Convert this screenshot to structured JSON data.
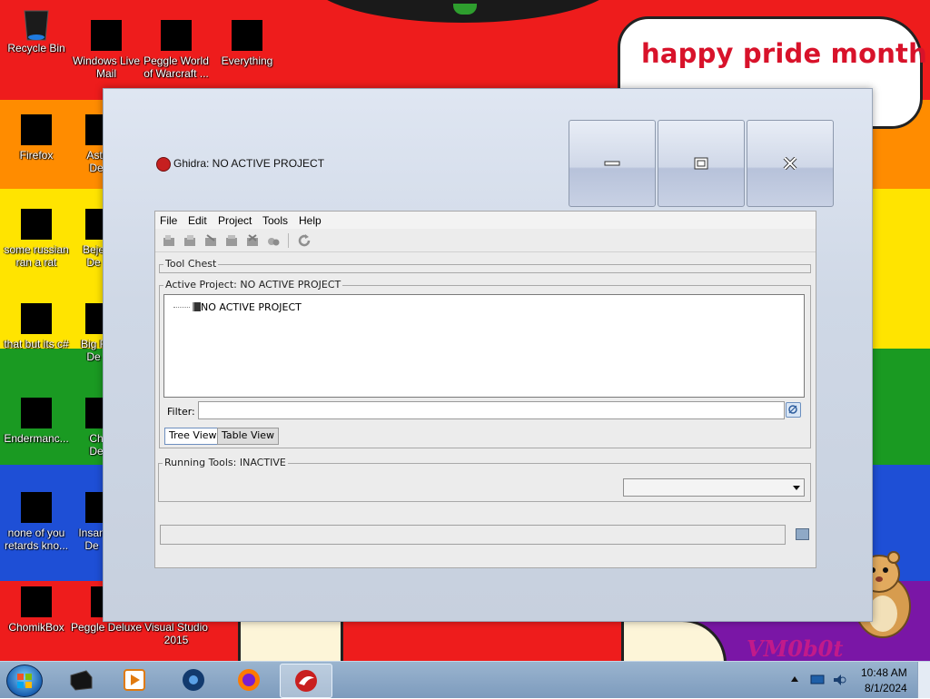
{
  "desktop": {
    "bubble_text": "happy pride month",
    "signature": "VM0b0t",
    "icons": [
      {
        "label": "Recycle Bin"
      },
      {
        "label": "Windows Live Mail"
      },
      {
        "label": "Peggle World of Warcraft ..."
      },
      {
        "label": "Everything"
      },
      {
        "label": "Firefox"
      },
      {
        "label": "Astr De"
      },
      {
        "label": "some russian ran a rat"
      },
      {
        "label": "Beje De"
      },
      {
        "label": "that but its c#"
      },
      {
        "label": "Big F De"
      },
      {
        "label": "Endermanc..."
      },
      {
        "label": "Ch De"
      },
      {
        "label": "none of you retards kno..."
      },
      {
        "label": "Insan De"
      },
      {
        "label": "ChomikBox"
      },
      {
        "label": "Peggle Deluxe"
      },
      {
        "label": "Visual Studio 2015"
      }
    ],
    "colors": {
      "red": "#ee1c1c",
      "orange": "#ff8c00",
      "yellow": "#ffe400",
      "green": "#1a9a22",
      "blue": "#1e4fd6",
      "purple": "#7a16a6"
    }
  },
  "window": {
    "title": "Ghidra: NO ACTIVE PROJECT",
    "menu": [
      "File",
      "Edit",
      "Project",
      "Tools",
      "Help"
    ],
    "toolbar_icons": [
      "new-project-icon",
      "open-project-icon",
      "close-project-icon",
      "save-project-icon",
      "delete-project-icon",
      "archive-icon",
      "refresh-icon"
    ],
    "tool_chest_title": "Tool Chest",
    "active_project_title": "Active Project: NO ACTIVE PROJECT",
    "tree_node": "NO ACTIVE PROJECT",
    "filter_label": "Filter:",
    "filter_value": "",
    "tabs": [
      "Tree View",
      "Table View"
    ],
    "selected_tab": "Tree View",
    "running_tools_title": "Running Tools: INACTIVE",
    "running_tools_selected": "",
    "status_text": ""
  },
  "taskbar": {
    "items": [
      "black-app-icon",
      "media-player-icon",
      "chromium-icon",
      "firefox-icon",
      "ghidra-icon"
    ],
    "time": "10:48 AM",
    "date": "8/1/2024"
  }
}
